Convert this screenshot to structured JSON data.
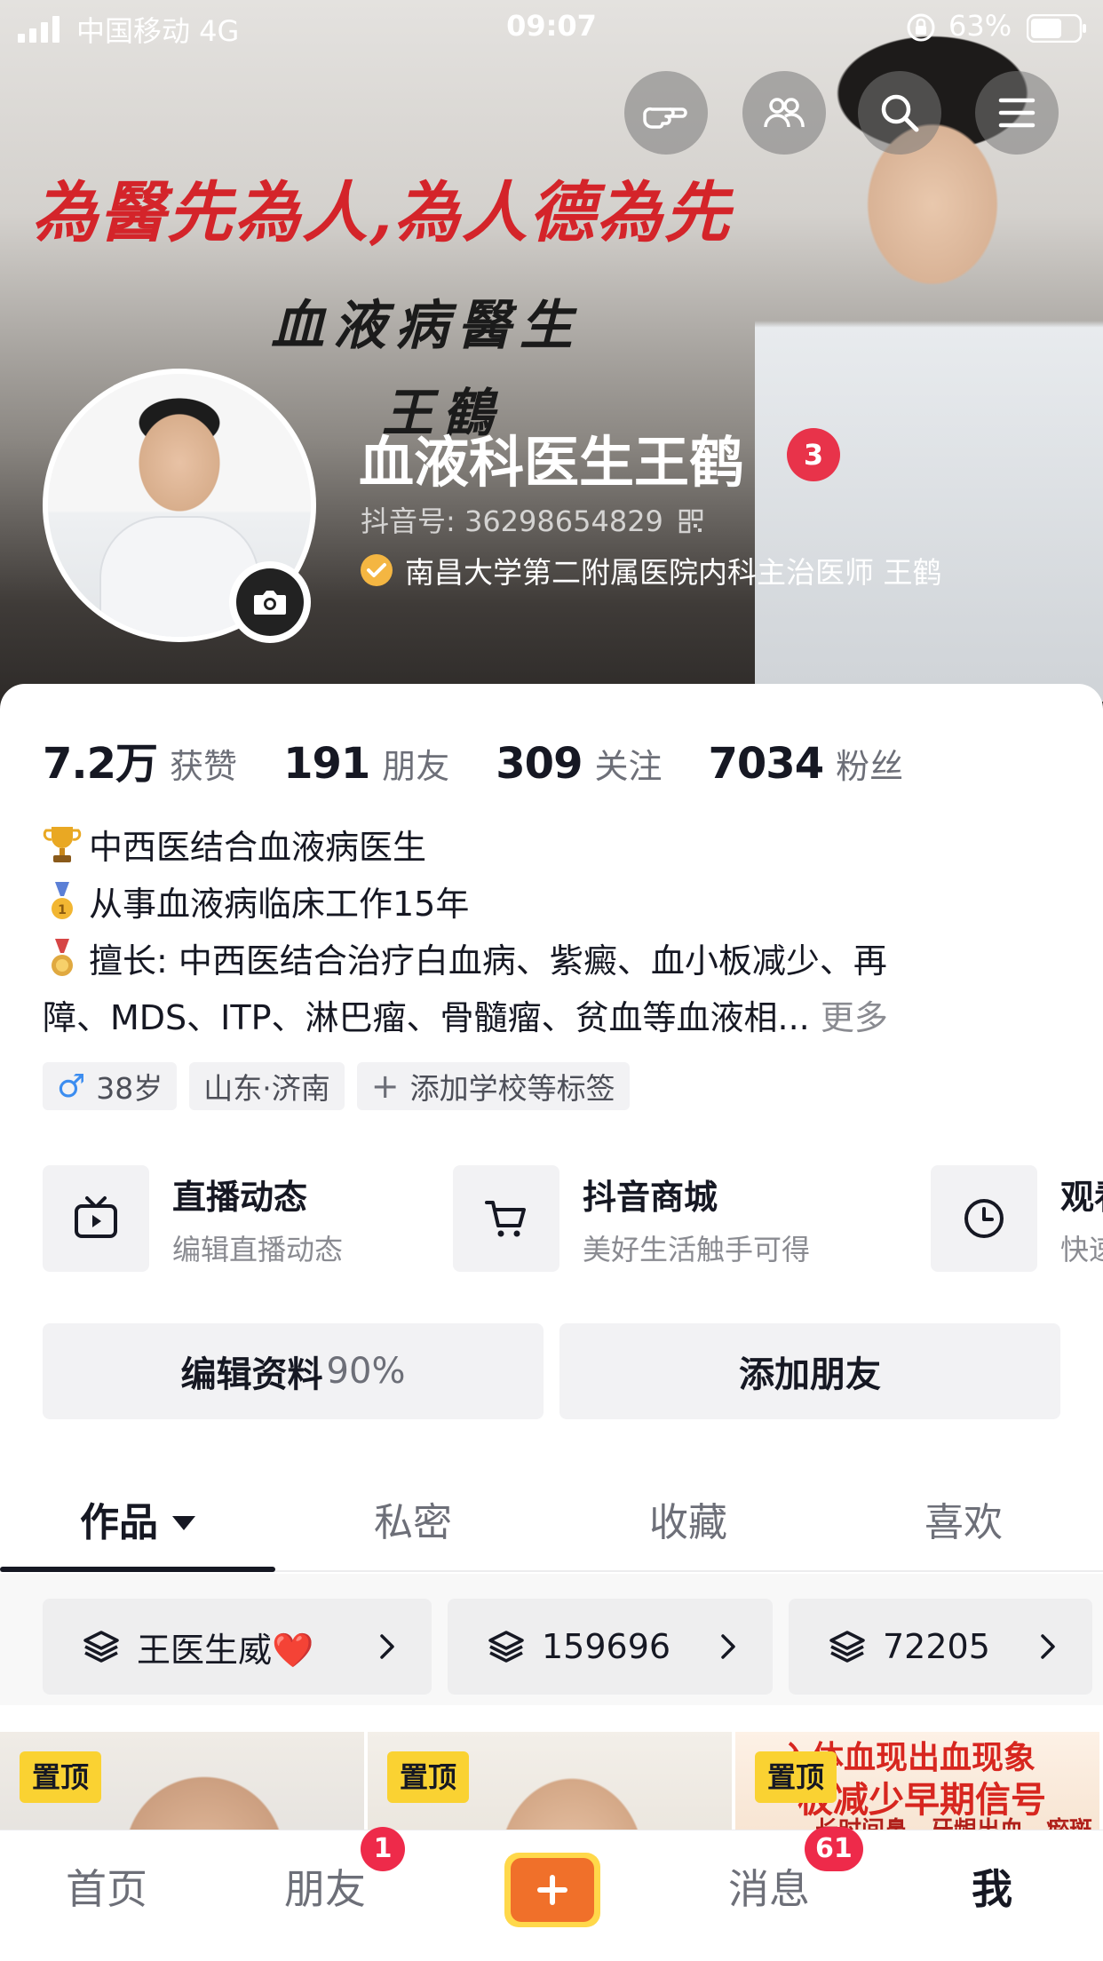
{
  "status_bar": {
    "carrier": "中国移动  4G",
    "time": "09:07",
    "battery": "63%"
  },
  "banner": {
    "calligraphy_line1": "為醫先為人,為人德為先",
    "calligraphy_line2": "血液病醫生",
    "calligraphy_line3": "王鶴"
  },
  "top_buttons": {
    "icons": [
      "hand-pointer-icon",
      "friends-icon",
      "search-icon",
      "menu-icon"
    ]
  },
  "profile": {
    "name": "血液科医生王鹤",
    "level": "3",
    "douyin_id": "抖音号: 36298654829",
    "verification": "南昌大学第二附属医院内科主治医师 王鹤"
  },
  "stats": [
    {
      "value": "7.2万",
      "label": "获赞"
    },
    {
      "value": "191",
      "label": "朋友"
    },
    {
      "value": "309",
      "label": "关注"
    },
    {
      "value": "7034",
      "label": "粉丝"
    }
  ],
  "bio": {
    "line1": "中西医结合血液病医生",
    "line2": "从事血液病临床工作15年",
    "line3": "擅长: 中西医结合治疗白血病、紫癜、血小板减少、再",
    "line4": "障、MDS、ITP、淋巴瘤、骨髓瘤、贫血等血液相...",
    "more": "更多"
  },
  "tags": {
    "age": "38岁",
    "location": "山东·济南",
    "add": "添加学校等标签"
  },
  "features": [
    {
      "title": "直播动态",
      "subtitle": "编辑直播动态",
      "icon": "tv-icon"
    },
    {
      "title": "抖音商城",
      "subtitle": "美好生活触手可得",
      "icon": "cart-icon"
    },
    {
      "title": "观看历史",
      "subtitle": "快速找到看过的视频",
      "icon": "clock-icon"
    }
  ],
  "actions": {
    "edit_profile": "编辑资料",
    "edit_percent": "90%",
    "add_friends": "添加朋友"
  },
  "tabs": [
    "作品",
    "私密",
    "收藏",
    "喜欢"
  ],
  "collections": [
    {
      "label": "王医生威❤️"
    },
    {
      "label": "159696"
    },
    {
      "label": "72205"
    }
  ],
  "thumbnails": {
    "pin_label": "置顶",
    "thumb3_line1": "入体血现出血现象",
    "thumb3_line2": "板减少早期信号",
    "thumb3_line3": "长时间鼻、牙龈出血、瘀斑"
  },
  "bottom_nav": {
    "home": "首页",
    "friends": "朋友",
    "friends_badge": "1",
    "messages": "消息",
    "messages_badge": "61",
    "me": "我"
  },
  "colors": {
    "accent_red": "#e8334a",
    "pin_yellow": "#fad232",
    "plus_orange": "#f0702a",
    "verify_gold": "#f4b642"
  }
}
